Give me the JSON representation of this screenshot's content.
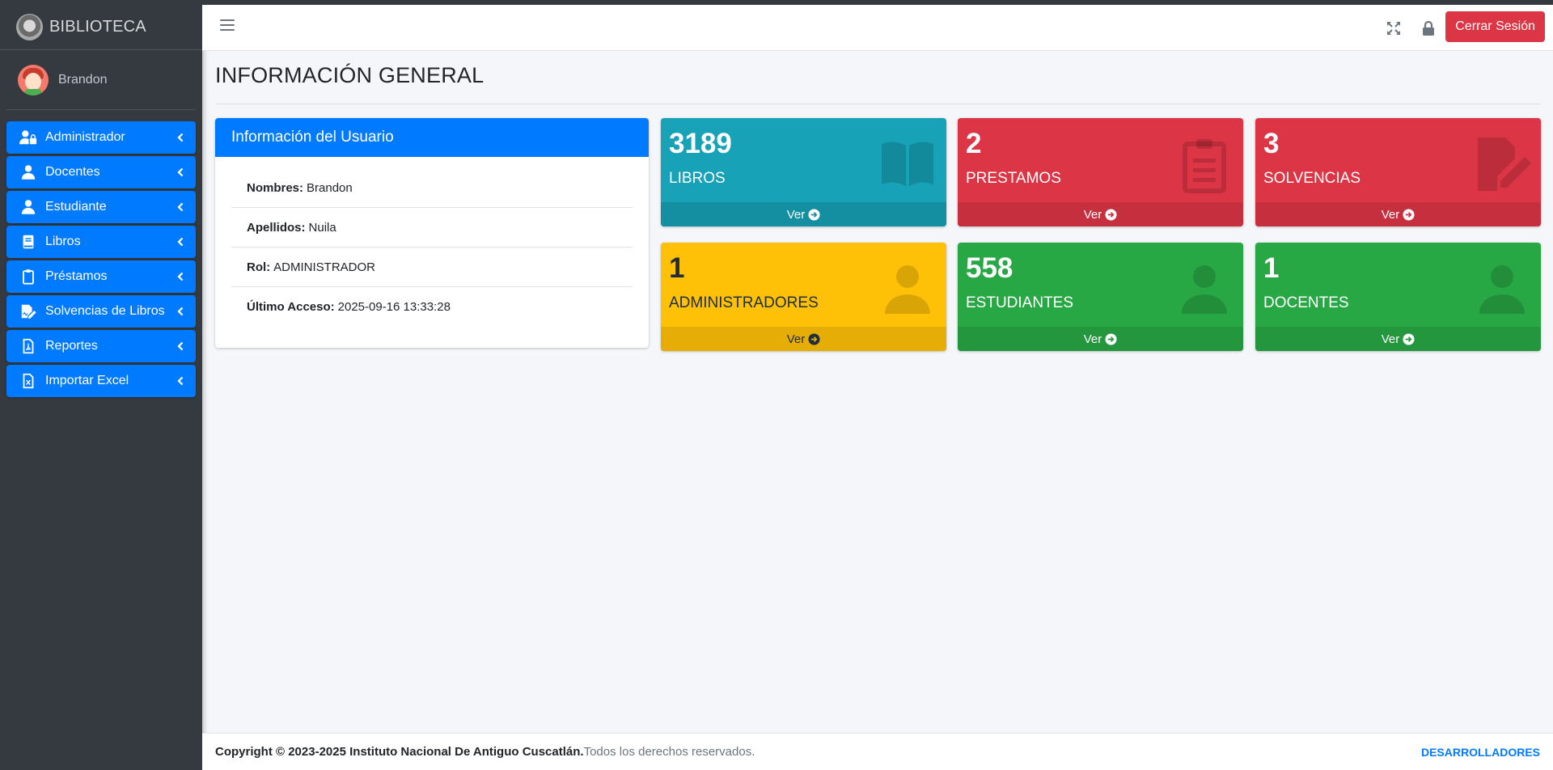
{
  "brand": {
    "name": "BIBLIOTECA"
  },
  "user": {
    "name": "Brandon"
  },
  "sidebar": {
    "items": [
      {
        "label": "Administrador",
        "icon": "user-lock-icon"
      },
      {
        "label": "Docentes",
        "icon": "user-icon"
      },
      {
        "label": "Estudiante",
        "icon": "user-icon"
      },
      {
        "label": "Libros",
        "icon": "book-icon"
      },
      {
        "label": "Préstamos",
        "icon": "clipboard-icon"
      },
      {
        "label": "Solvencias de Libros",
        "icon": "file-signature-icon"
      },
      {
        "label": "Reportes",
        "icon": "file-pdf-icon"
      },
      {
        "label": "Importar Excel",
        "icon": "file-excel-icon"
      }
    ]
  },
  "header": {
    "logout_label": "Cerrar Sesión"
  },
  "page": {
    "title": "INFORMACIÓN GENERAL"
  },
  "user_card": {
    "title": "Información del Usuario",
    "rows": [
      {
        "key": "Nombres:",
        "value": "Brandon"
      },
      {
        "key": "Apellidos:",
        "value": "Nuila"
      },
      {
        "key": "Rol:",
        "value": "ADMINISTRADOR"
      },
      {
        "key": "Último Acceso:",
        "value": "2025-09-16 13:33:28"
      }
    ]
  },
  "stats": [
    {
      "value": "3189",
      "label": "LIBROS",
      "link": "Ver",
      "color": "#17a2b8",
      "icon": "book-open-icon"
    },
    {
      "value": "2",
      "label": "PRESTAMOS",
      "link": "Ver",
      "color": "#dc3545",
      "icon": "clipboard-list-icon"
    },
    {
      "value": "3",
      "label": "SOLVENCIAS",
      "link": "Ver",
      "color": "#dc3545",
      "icon": "file-signature-icon"
    },
    {
      "value": "1",
      "label": "ADMINISTRADORES",
      "link": "Ver",
      "color": "#ffc107",
      "icon": "user-icon"
    },
    {
      "value": "558",
      "label": "ESTUDIANTES",
      "link": "Ver",
      "color": "#28a745",
      "icon": "user-icon"
    },
    {
      "value": "1",
      "label": "DOCENTES",
      "link": "Ver",
      "color": "#28a745",
      "icon": "user-icon"
    }
  ],
  "footer": {
    "copyright": "Copyright © 2023-2025 Instituto Nacional De Antiguo Cuscatlán.",
    "rights": "Todos los derechos reservados.",
    "developers": "DESARROLLADORES"
  }
}
